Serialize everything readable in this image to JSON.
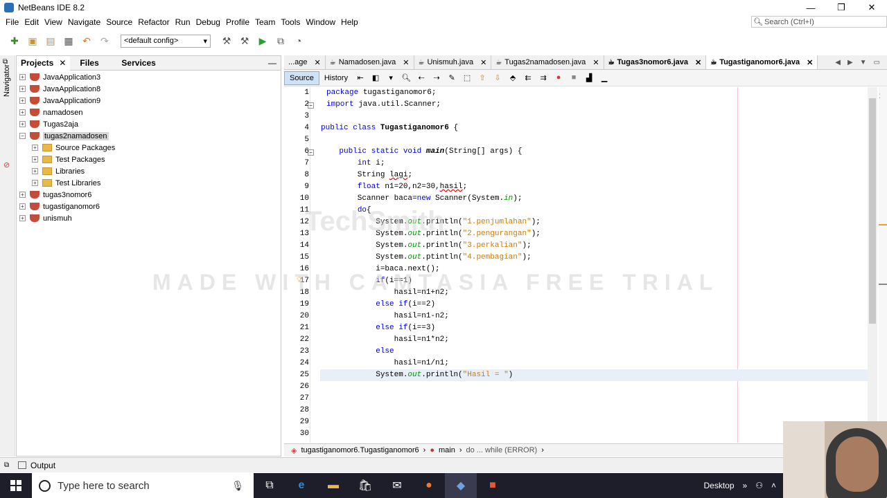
{
  "app": {
    "title": "NetBeans IDE 8.2"
  },
  "window_controls": {
    "minimize": "—",
    "restore": "❐",
    "close": "✕"
  },
  "menu": [
    "File",
    "Edit",
    "View",
    "Navigate",
    "Source",
    "Refactor",
    "Run",
    "Debug",
    "Profile",
    "Team",
    "Tools",
    "Window",
    "Help"
  ],
  "search": {
    "placeholder": "Search (Ctrl+I)"
  },
  "toolbar": {
    "config": "<default config>"
  },
  "navigator": {
    "label": "Navigator"
  },
  "projects_panel": {
    "tabs": [
      "Projects",
      "Files",
      "Services"
    ],
    "tree": [
      {
        "label": "JavaApplication3",
        "level": 0,
        "icon": "cup"
      },
      {
        "label": "JavaApplication8",
        "level": 0,
        "icon": "cup"
      },
      {
        "label": "JavaApplication9",
        "level": 0,
        "icon": "cup"
      },
      {
        "label": "namadosen",
        "level": 0,
        "icon": "cup"
      },
      {
        "label": "Tugas2aja",
        "level": 0,
        "icon": "cup"
      },
      {
        "label": "tugas2namadosen",
        "level": 0,
        "icon": "cup",
        "selected": true,
        "expanded": true
      },
      {
        "label": "Source Packages",
        "level": 1,
        "icon": "folder"
      },
      {
        "label": "Test Packages",
        "level": 1,
        "icon": "folder"
      },
      {
        "label": "Libraries",
        "level": 1,
        "icon": "folder"
      },
      {
        "label": "Test Libraries",
        "level": 1,
        "icon": "folder"
      },
      {
        "label": "tugas3nomor6",
        "level": 0,
        "icon": "cup"
      },
      {
        "label": "tugastiganomor6",
        "level": 0,
        "icon": "cup"
      },
      {
        "label": "unismuh",
        "level": 0,
        "icon": "cup"
      }
    ]
  },
  "editor": {
    "tabs": [
      {
        "label": "...age",
        "partial": true
      },
      {
        "label": "Namadosen.java"
      },
      {
        "label": "Unismuh.java"
      },
      {
        "label": "Tugas2namadosen.java"
      },
      {
        "label": "Tugas3nomor6.java",
        "bold": true
      },
      {
        "label": "Tugastiganomor6.java",
        "active": true
      }
    ],
    "source_label": "Source",
    "history_label": "History",
    "lines": [
      {
        "n": "1",
        "html": "<span class=\"kw\">package</span> tugastiganomor6;",
        "indent": 1
      },
      {
        "n": "2",
        "html": "<span class=\"kw\">import</span> java.util.Scanner;",
        "indent": 1
      },
      {
        "n": "3",
        "html": "",
        "indent": 0
      },
      {
        "n": "4",
        "html": "<span class=\"kw\">public class</span> <span class=\"bold\">Tugastiganomor6</span> {",
        "indent": 0
      },
      {
        "n": "5",
        "html": "",
        "indent": 0
      },
      {
        "n": "6",
        "html": "    <span class=\"kw\">public static void</span> <span class=\"mth\">main</span>(String[] args) {",
        "indent": 0
      },
      {
        "n": "7",
        "html": "        <span class=\"kw\">int</span> i;",
        "indent": 0
      },
      {
        "n": "8",
        "html": "        String <span class=\"errul\">lagi</span>;",
        "indent": 0
      },
      {
        "n": "9",
        "html": "        <span class=\"kw\">float</span> n1=20,n2=30,<span class=\"errul\">hasil</span>;",
        "indent": 0
      },
      {
        "n": "10",
        "html": "        Scanner baca=<span class=\"kw\">new</span> Scanner(System.<span class=\"fld\">in</span>);",
        "indent": 0
      },
      {
        "n": "11",
        "html": "        <span class=\"kw\">do</span>{",
        "indent": 0
      },
      {
        "n": "12",
        "html": "            System.<span class=\"fld\">out</span>.println(<span class=\"str\">\"1.penjumlahan\"</span>);",
        "indent": 0
      },
      {
        "n": "13",
        "html": "            System.<span class=\"fld\">out</span>.println(<span class=\"str\">\"2.pengurangan\"</span>);",
        "indent": 0
      },
      {
        "n": "14",
        "html": "            System.<span class=\"fld\">out</span>.println(<span class=\"str\">\"3.perkalian\"</span>);",
        "indent": 0
      },
      {
        "n": "15",
        "html": "            System.<span class=\"fld\">out</span>.ptintln(<span class=\"str\">\"4.pembagian\"</span>);",
        "indent": 0
      },
      {
        "n": "16",
        "html": "            i=baca.next();",
        "indent": 0
      },
      {
        "n": "17",
        "html": "            <span class=\"kw\">if</span>(i==1)",
        "indent": 0
      },
      {
        "n": "18",
        "html": "                hasil=n1+n2;",
        "indent": 0
      },
      {
        "n": "19",
        "html": "            <span class=\"kw\">else if</span>(i==2)",
        "indent": 0
      },
      {
        "n": "20",
        "html": "                hasil=n1-n2;",
        "indent": 0
      },
      {
        "n": "21",
        "html": "            <span class=\"kw\">else if</span>(i==3)",
        "indent": 0
      },
      {
        "n": "22",
        "html": "                hasil=n1*n2;",
        "indent": 0
      },
      {
        "n": "23",
        "html": "            <span class=\"kw\">else</span>",
        "indent": 0
      },
      {
        "n": "24",
        "html": "                hasil=n1/n1;",
        "indent": 0
      },
      {
        "n": "25",
        "html": "            System.<span class=\"fld\">out</span>.println(<span class=\"str\">\"Hasil = \"</span>)",
        "indent": 0,
        "current": true
      },
      {
        "n": "26",
        "html": "",
        "indent": 0
      },
      {
        "n": "27",
        "html": "",
        "indent": 0
      },
      {
        "n": "28",
        "html": "",
        "indent": 0
      },
      {
        "n": "29",
        "html": "",
        "indent": 0
      },
      {
        "n": "30",
        "html": "",
        "indent": 0
      }
    ],
    "breadcrumb": [
      "tugastiganomor6.Tugastiganomor6",
      "main",
      "do ... while (ERROR)"
    ]
  },
  "output": {
    "label": "Output"
  },
  "watermark": {
    "text": "MADE WITH CAMTASIA FREE TRIAL",
    "logo": "TechSmith"
  },
  "taskbar": {
    "search_placeholder": "Type here to search",
    "desktop_label": "Desktop",
    "apps": [
      "task-view",
      "edge",
      "file-explorer",
      "store",
      "mail",
      "firefox",
      "netbeans",
      "camtasia"
    ]
  }
}
